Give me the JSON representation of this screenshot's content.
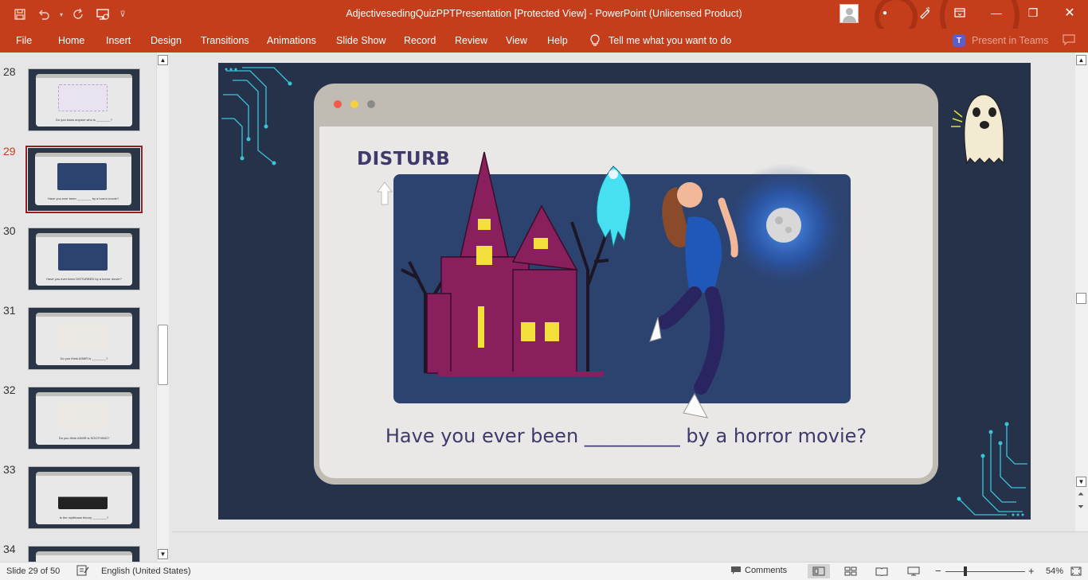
{
  "window": {
    "title": "AdjectivesedingQuizPPTPresentation [Protected View]  -  PowerPoint (Unlicensed Product)",
    "accent": "#c43e1c"
  },
  "qat": {
    "icons": [
      "save-icon",
      "undo-icon",
      "redo-icon",
      "present-from-start-icon",
      "customize-icon"
    ]
  },
  "menu": {
    "items": [
      "File",
      "Home",
      "Insert",
      "Design",
      "Transitions",
      "Animations",
      "Slide Show",
      "Record",
      "Review",
      "View",
      "Help"
    ],
    "tell_me": "Tell me what you want to do",
    "present_in_teams": "Present in Teams"
  },
  "thumbnails": [
    {
      "number": "28",
      "caption": "Do you know anyone who is ________?"
    },
    {
      "number": "29",
      "caption": "Have you ever been ________ by a horror movie?",
      "selected": true
    },
    {
      "number": "30",
      "caption": "Have you ever been DISTURBED by a horror movie?"
    },
    {
      "number": "31",
      "caption": "Do you think ASMR is ________?"
    },
    {
      "number": "32",
      "caption": "Do you think ASMR is SOOTHING?"
    },
    {
      "number": "33",
      "caption": "Is the mythbase theory ________?"
    },
    {
      "number": "34",
      "caption": ""
    }
  ],
  "slide": {
    "title": "DISTURB",
    "question": "Have you ever been __________ by a horror movie?"
  },
  "status": {
    "slide_info": "Slide 29 of 50",
    "language": "English (United States)",
    "comments": "Comments",
    "zoom": "54%"
  }
}
